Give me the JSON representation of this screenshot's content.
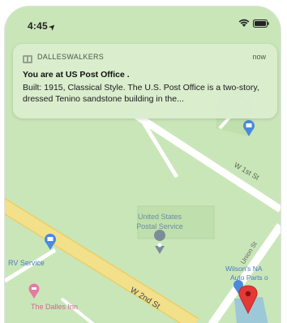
{
  "status_bar": {
    "time": "4:45",
    "location_arrow": "➤",
    "wifi_icon": "wifi-icon",
    "battery_icon": "battery-icon"
  },
  "notification": {
    "app_icon": "app-icon",
    "app_name": "DALLESWALKERS",
    "time": "now",
    "title": "You are at US Post Office .",
    "body": "Built: 1915, Classical Style.  The U.S. Post Office is a two-story, dressed Tenino sandstone building in the..."
  },
  "map": {
    "labels": {
      "w_1st_st": "W 1st St",
      "post_office_line1": "United States",
      "post_office_line2": "Postal Service",
      "rv_service": "RV Service",
      "w_2nd_st": "W 2nd St",
      "union_st": "Union St",
      "wilsons_line1": "Wilson's NA",
      "wilsons_line2": "Auto Parts o",
      "dalles_inn": "The Dalles Inn"
    },
    "colors": {
      "land": "#c9e6b9",
      "park": "#bfe0ad",
      "road": "#ffffff",
      "highway": "#f2e08a",
      "water": "#9dc8d8",
      "pin_red": "#e53935",
      "poi_blue": "#4a89dc",
      "poi_pink": "#e57aa3"
    }
  }
}
